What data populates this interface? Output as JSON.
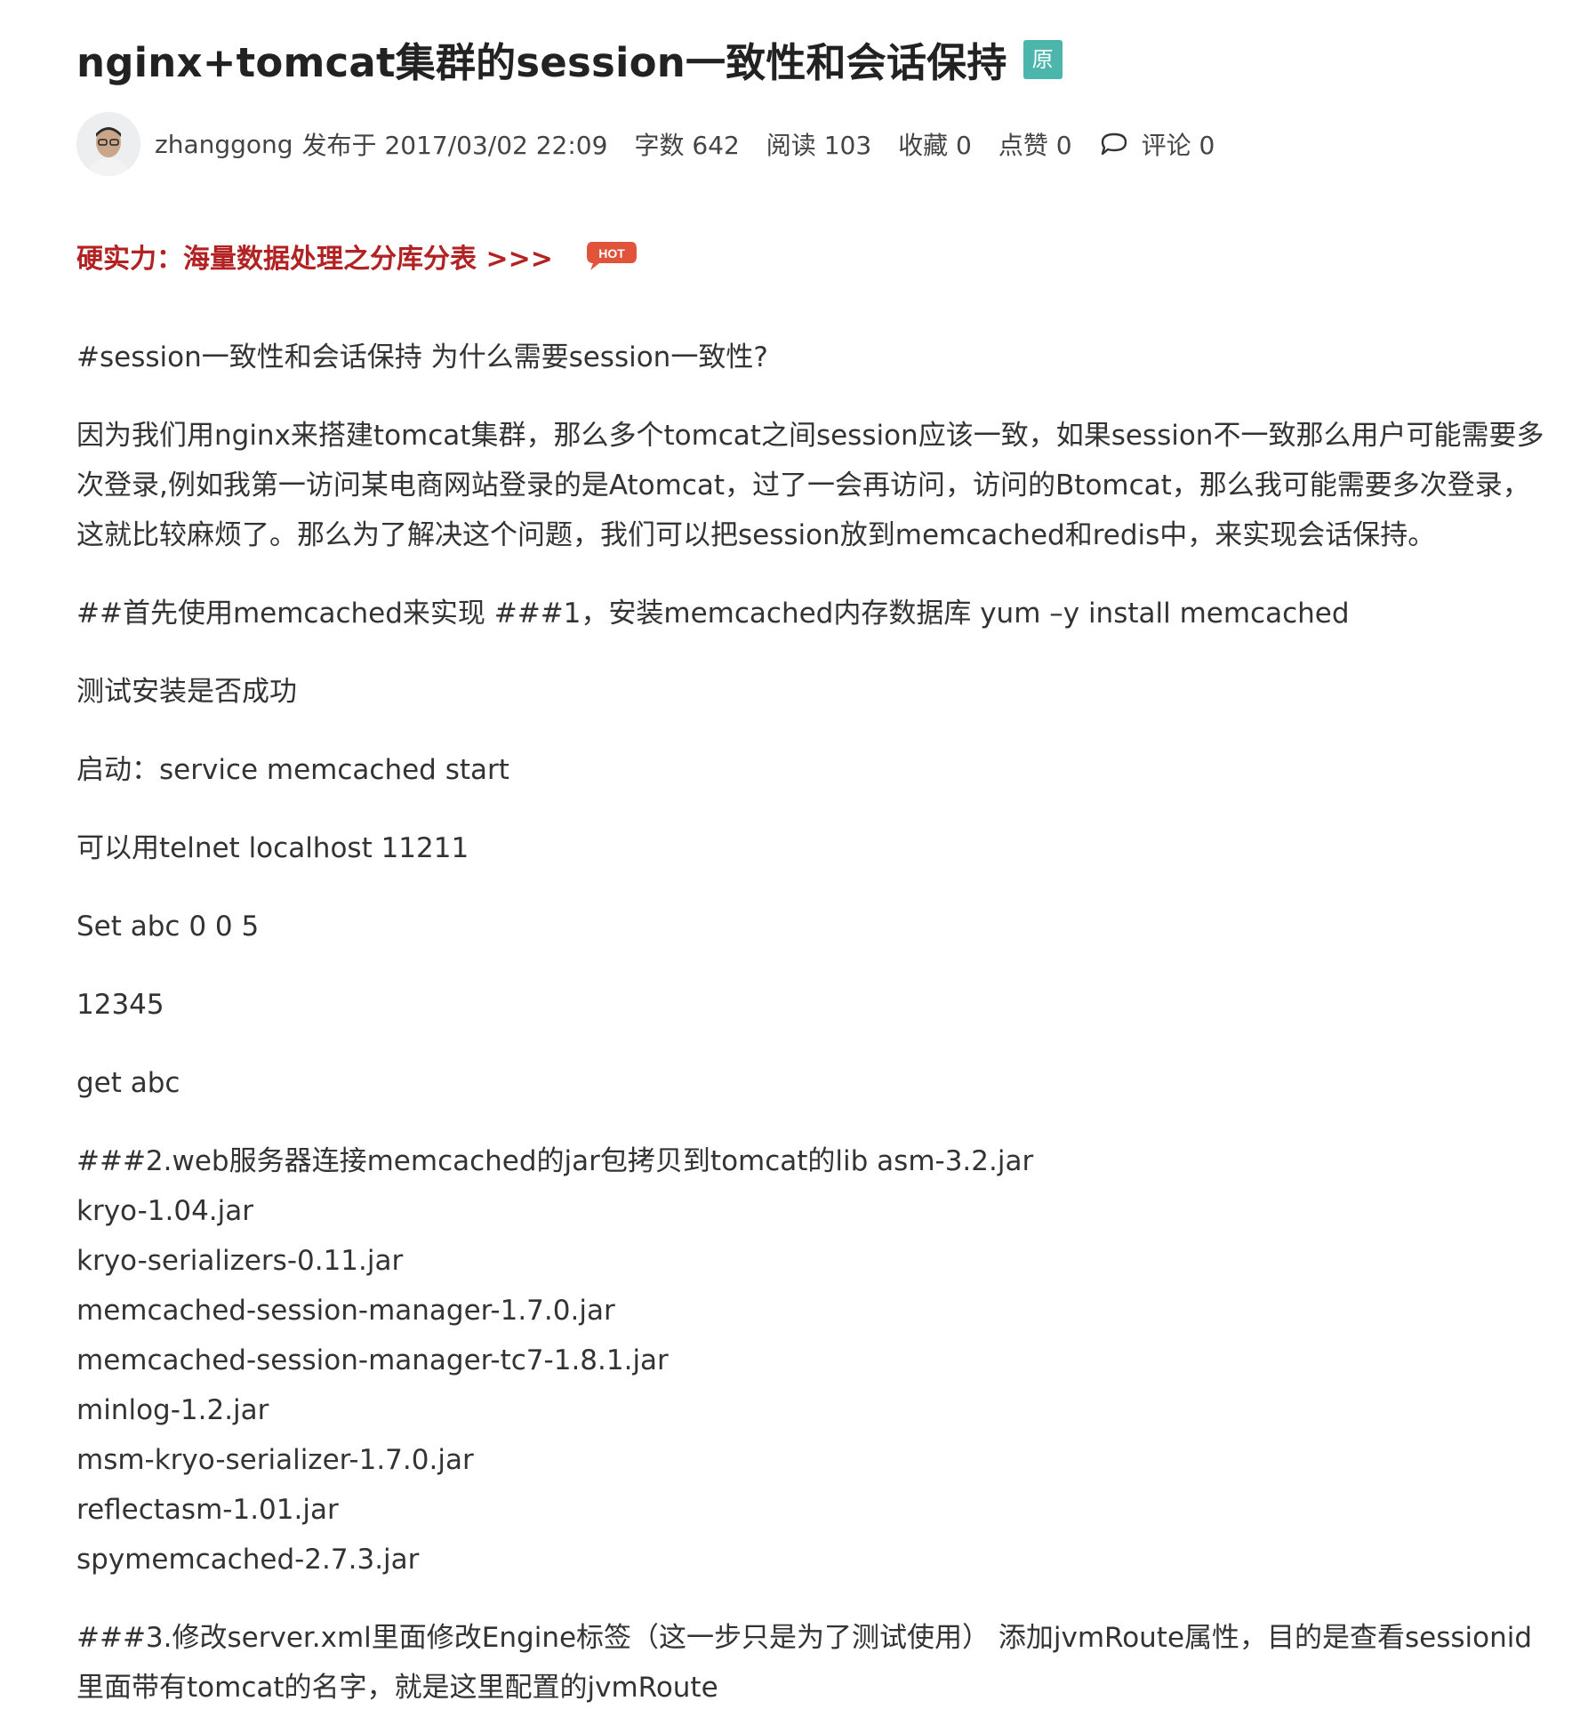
{
  "article": {
    "title": "nginx+tomcat集群的session一致性和会话保持",
    "original_badge": "原",
    "meta": {
      "author": "zhanggong",
      "published": "发布于 2017/03/02 22:09",
      "word_count": "字数 642",
      "reads": "阅读 103",
      "favorites": "收藏 0",
      "likes": "点赞 0",
      "comments": "评论 0"
    },
    "promo": {
      "link_text": "硬实力：海量数据处理之分库分表 >>>",
      "badge": "HOT"
    },
    "paragraphs": [
      "#session一致性和会话保持 为什么需要session一致性?",
      "因为我们用nginx来搭建tomcat集群，那么多个tomcat之间session应该一致，如果session不一致那么用户可能需要多次登录,例如我第一访问某电商网站登录的是Atomcat，过了一会再访问，访问的Btomcat，那么我可能需要多次登录，这就比较麻烦了。那么为了解决这个问题，我们可以把session放到memcached和redis中，来实现会话保持。",
      "##首先使用memcached来实现 ###1，安装memcached内存数据库 yum –y install memcached",
      "测试安装是否成功",
      "启动：service memcached start",
      "可以用telnet localhost 11211",
      "Set abc 0 0 5",
      "12345",
      "get abc"
    ],
    "jar_section": {
      "heading": "###2.web服务器连接memcached的jar包拷贝到tomcat的lib asm-3.2.jar",
      "jars": [
        "kryo-1.04.jar",
        "kryo-serializers-0.11.jar",
        "memcached-session-manager-1.7.0.jar",
        "memcached-session-manager-tc7-1.8.1.jar",
        "minlog-1.2.jar",
        "msm-kryo-serializer-1.7.0.jar",
        "reflectasm-1.01.jar",
        "spymemcached-2.7.3.jar"
      ]
    },
    "last_paragraph": "###3.修改server.xml里面修改Engine标签（这一步只是为了测试使用） 添加jvmRoute属性，目的是查看sessionid里面带有tomcat的名字，就是这里配置的jvmRoute"
  },
  "colors": {
    "badge_teal": "#4db6ac",
    "promo_red": "#b22222",
    "hot_red": "#e2533c",
    "text": "#333333"
  },
  "icons": [
    "avatar-image",
    "comment-icon",
    "hot-badge"
  ]
}
